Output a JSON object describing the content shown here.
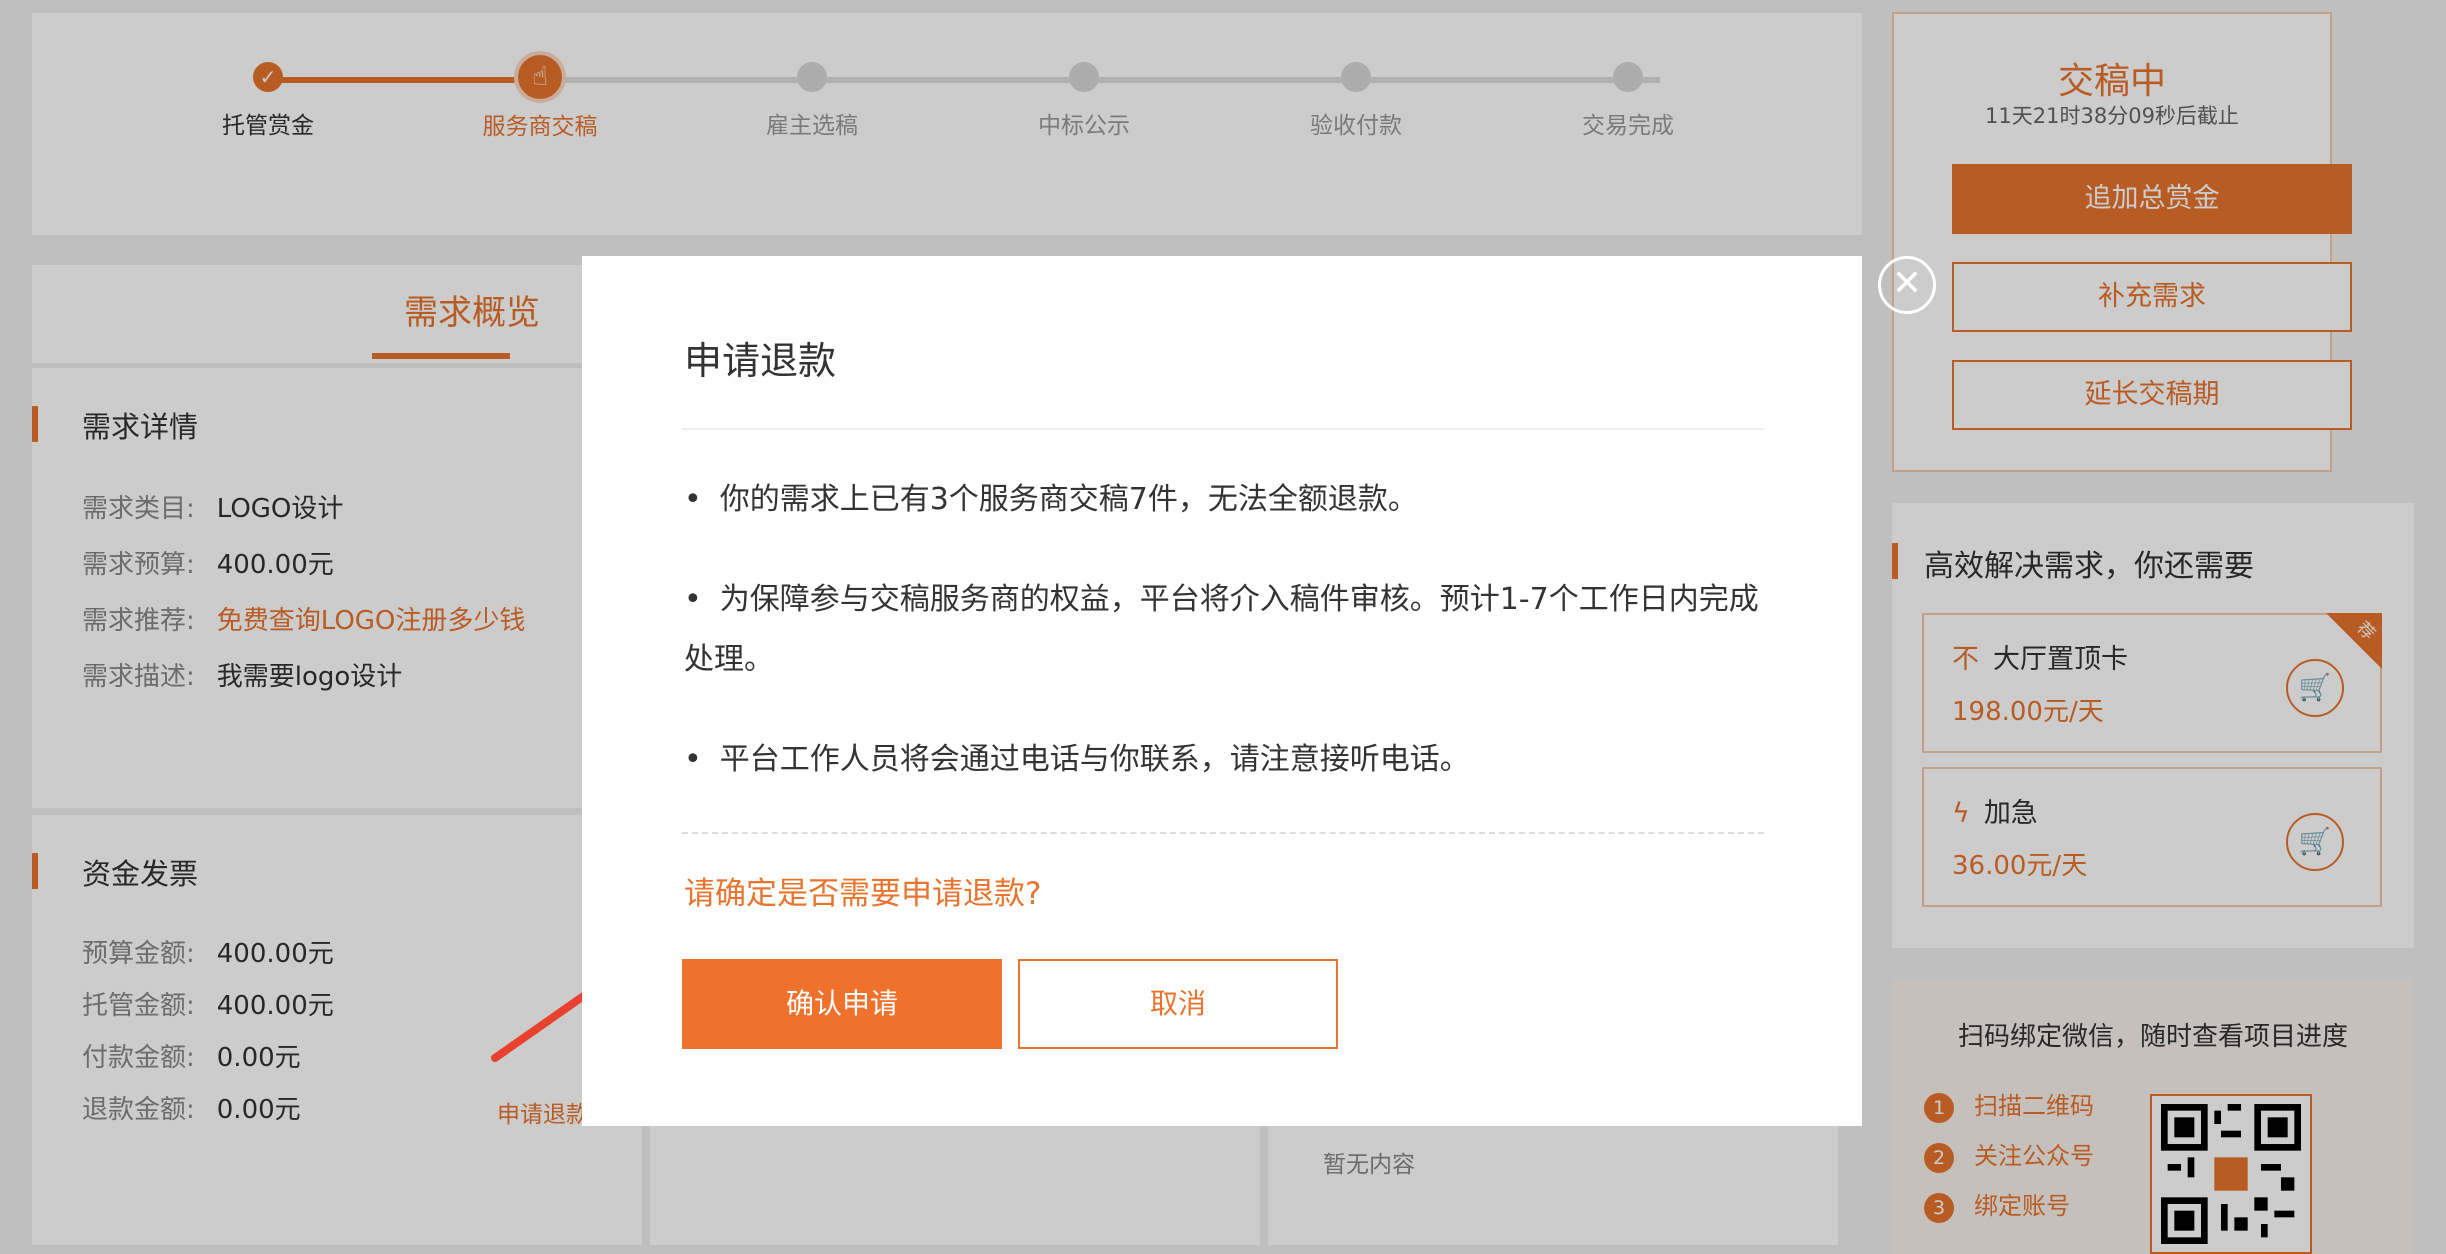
{
  "steps": [
    {
      "label": "托管赏金",
      "state": "done"
    },
    {
      "label": "服务商交稿",
      "state": "current"
    },
    {
      "label": "雇主选稿",
      "state": "todo"
    },
    {
      "label": "中标公示",
      "state": "todo"
    },
    {
      "label": "验收付款",
      "state": "todo"
    },
    {
      "label": "交易完成",
      "state": "todo"
    }
  ],
  "overview": {
    "tab": "需求概览"
  },
  "details": {
    "title": "需求详情",
    "rows": [
      {
        "k": "需求类目:",
        "v": "LOGO设计"
      },
      {
        "k": "需求预算:",
        "v": "400.00元"
      },
      {
        "k": "需求推荐:",
        "v": "免费查询LOGO注册多少钱"
      },
      {
        "k": "需求描述:",
        "v": "我需要logo设计"
      }
    ]
  },
  "funds": {
    "title": "资金发票",
    "rows": [
      {
        "k": "预算金额:",
        "v": "400.00元"
      },
      {
        "k": "托管金额:",
        "v": "400.00元"
      },
      {
        "k": "付款金额:",
        "v": "0.00元"
      },
      {
        "k": "退款金额:",
        "v": "0.00元"
      }
    ],
    "refund_link": "申请退款"
  },
  "col3": {
    "empty": "暂无内容"
  },
  "status": {
    "title": "交稿中",
    "countdown": "11天21时38分09秒后截止",
    "add_bounty": "追加总赏金",
    "supplement": "补充需求",
    "extend": "延长交稿期"
  },
  "services": {
    "title": "高效解决需求，你还需要",
    "items": [
      {
        "icon": "不",
        "name": "大厅置顶卡",
        "price": "198.00元/天",
        "ribbon": "荐"
      },
      {
        "icon": "ϟ",
        "name": "加急",
        "price": "36.00元/天"
      }
    ]
  },
  "wechat": {
    "title": "扫码绑定微信，随时查看项目进度",
    "steps": [
      {
        "num": "1",
        "text": "扫描二维码"
      },
      {
        "num": "2",
        "text": "关注公众号"
      },
      {
        "num": "3",
        "text": "绑定账号"
      }
    ]
  },
  "modal": {
    "title": "申请退款",
    "bullets": [
      "你的需求上已有3个服务商交稿7件，无法全额退款。",
      "为保障参与交稿服务商的权益，平台将介入稿件审核。预计1-7个工作日内完成处理。",
      "平台工作人员将会通过电话与你联系，请注意接听电话。"
    ],
    "question": "请确定是否需要申请退款?",
    "confirm": "确认申请",
    "cancel": "取消",
    "close": "✕"
  },
  "colors": {
    "accent": "#e8742e",
    "arrow": "#e8412e"
  }
}
